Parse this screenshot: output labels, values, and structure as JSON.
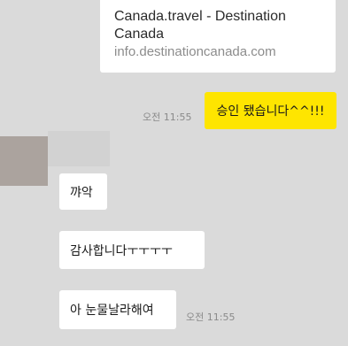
{
  "link_preview": {
    "title": "Canada.travel - Destination Canada",
    "url": "info.destinationcanada.com"
  },
  "messages": [
    {
      "sender": "me",
      "text": "승인 됐습니다^^!!!",
      "time": "오전 11:55"
    },
    {
      "sender": "other",
      "text": "꺄악"
    },
    {
      "sender": "other",
      "text": "감사합니다ㅜㅜㅜㅜ"
    },
    {
      "sender": "other",
      "text": "아 눈물날라해여",
      "time": "오전 11:55"
    }
  ],
  "colors": {
    "background": "#dadada",
    "my_bubble": "#fee500",
    "other_bubble": "#ffffff"
  }
}
